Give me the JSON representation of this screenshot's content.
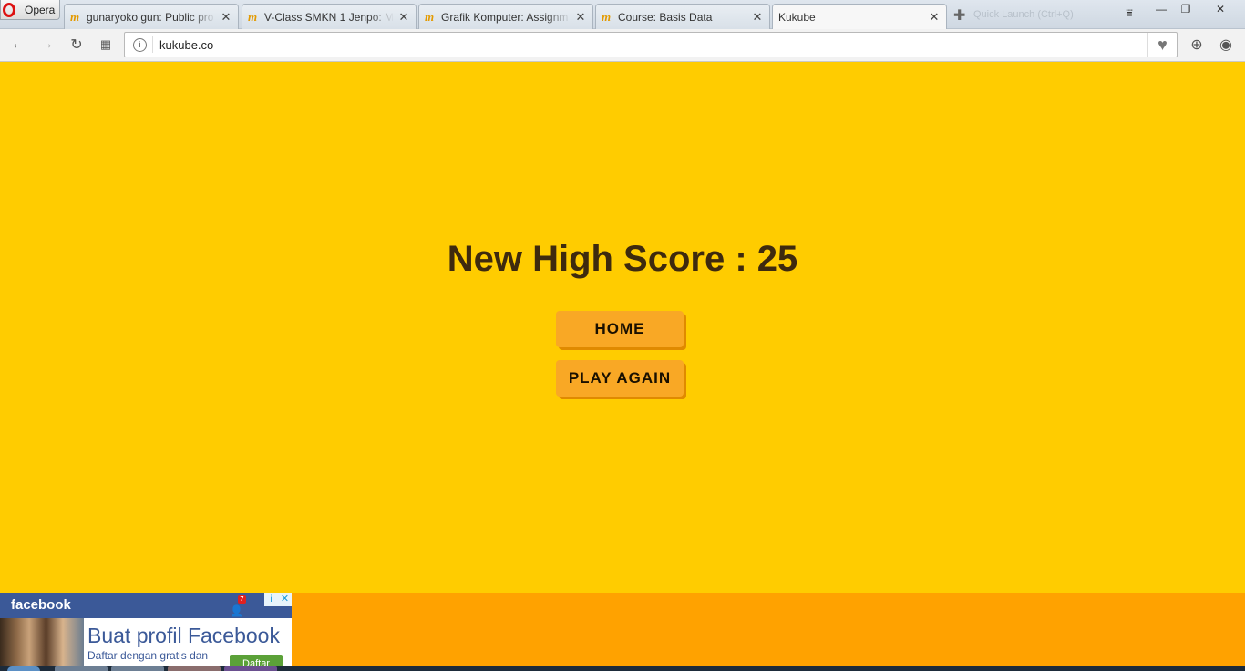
{
  "browser": {
    "menu_label": "Opera",
    "tabs": [
      {
        "label": "gunaryoko gun: Public pro",
        "favicon": "m"
      },
      {
        "label": "V-Class SMKN 1 Jenpo: My",
        "favicon": "m"
      },
      {
        "label": "Grafik Komputer: Assignm",
        "favicon": "m"
      },
      {
        "label": "Course: Basis Data",
        "favicon": "m"
      },
      {
        "label": "Kukube",
        "favicon": "page"
      }
    ],
    "quick_launch": "Quick Launch (Ctrl+Q)",
    "url": "kukube.co"
  },
  "game": {
    "score_text": "New High Score : 25",
    "home_label": "HOME",
    "play_again_label": "PLAY AGAIN"
  },
  "fb_ad": {
    "brand": "facebook",
    "badge": "7",
    "headline": "Buat profil Facebook",
    "sub": "Daftar dengan gratis dan",
    "cta": "Daftar"
  },
  "colors": {
    "page_bg": "#ffcc00",
    "footer_band": "#ffa200",
    "button": "#f9a825",
    "score_text": "#3e2a0e",
    "facebook": "#3b5998"
  }
}
